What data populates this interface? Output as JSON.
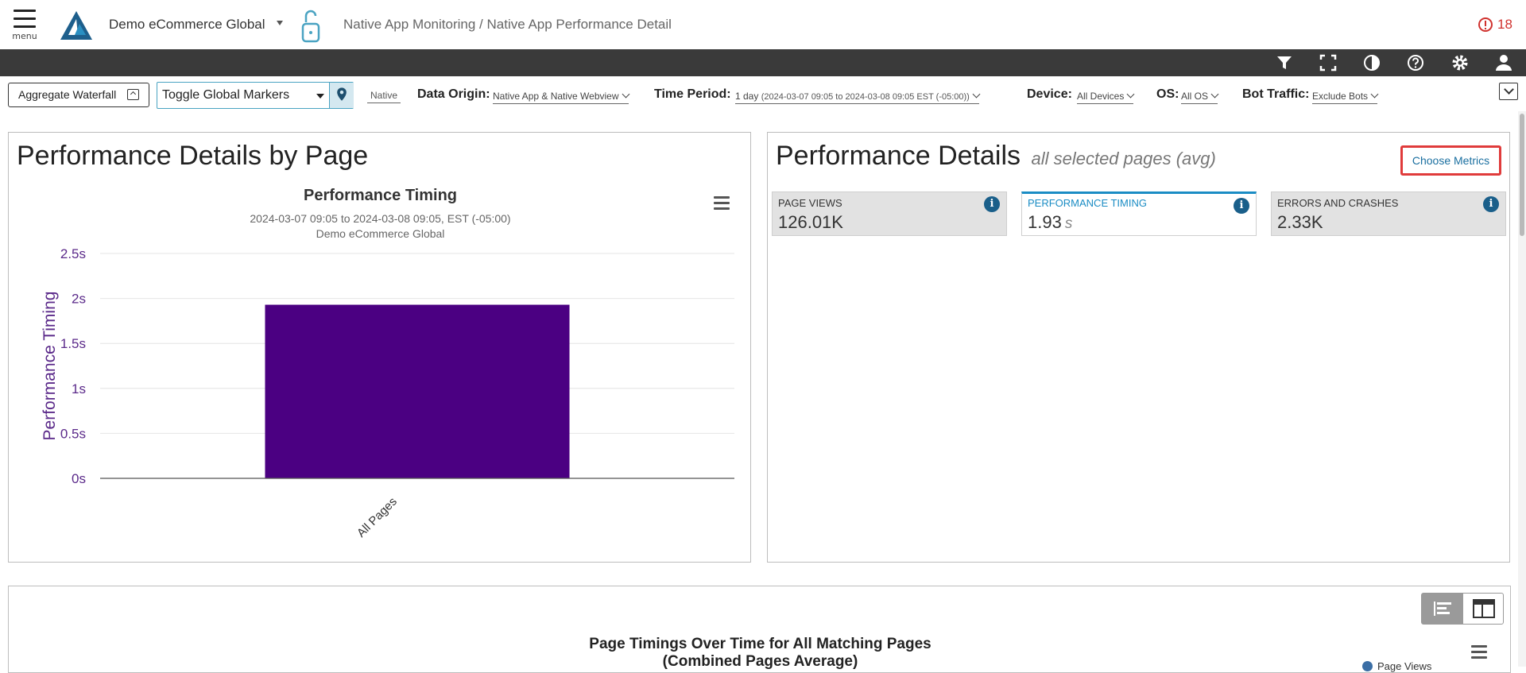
{
  "header": {
    "menu_label": "menu",
    "app_name": "Demo eCommerce Global",
    "breadcrumb": "Native App Monitoring / Native App Performance Detail",
    "alert_count": "18"
  },
  "toolbar_icons": [
    "filter-icon",
    "fullscreen-icon",
    "contrast-icon",
    "help-icon",
    "gear-icon",
    "user-icon"
  ],
  "filters": {
    "aggregate_waterfall_label": "Aggregate Waterfall",
    "global_markers": "Toggle Global Markers",
    "native_tag": "Native",
    "data_origin_label": "Data Origin:",
    "data_origin_value": "Native App & Native Webview",
    "time_period_label": "Time Period:",
    "time_period_value": "1 day",
    "time_period_range": "(2024-03-07 09:05 to 2024-03-08 09:05 EST (-05:00))",
    "device_label": "Device:",
    "device_value": "All Devices",
    "os_label": "OS:",
    "os_value": "All OS",
    "bot_label": "Bot Traffic:",
    "bot_value": "Exclude Bots"
  },
  "left_panel": {
    "title": "Performance Details by Page"
  },
  "chart_data": {
    "type": "bar",
    "title": "Performance Timing",
    "subtitle": "2024-03-07 09:05 to 2024-03-08 09:05, EST (-05:00)",
    "subtitle2": "Demo eCommerce Global",
    "categories": [
      "All Pages"
    ],
    "values": [
      1.93
    ],
    "ylabel": "Performance Timing",
    "xlabel": "",
    "ylim": [
      0,
      2.5
    ],
    "yticks": [
      "0s",
      "0.5s",
      "1s",
      "1.5s",
      "2s",
      "2.5s"
    ],
    "ytick_values": [
      0,
      0.5,
      1,
      1.5,
      2,
      2.5
    ],
    "bar_color": "#4b0082",
    "axis_color": "#5b2a8a",
    "grid": true
  },
  "right_panel": {
    "title": "Performance Details",
    "subtitle": "all selected pages (avg)",
    "choose_metrics_label": "Choose Metrics",
    "metrics": [
      {
        "label": "Page Views",
        "value": "126.01K",
        "unit": "",
        "active": false
      },
      {
        "label": "Performance Timing",
        "value": "1.93",
        "unit": "s",
        "active": true
      },
      {
        "label": "Errors and Crashes",
        "value": "2.33K",
        "unit": "",
        "active": false
      }
    ]
  },
  "bottom_panel": {
    "title_line1": "Page Timings Over Time for All Matching Pages",
    "title_line2": "(Combined Pages Average)",
    "legend_item": "Page Views"
  },
  "colors": {
    "accent": "#1a8cc4",
    "alert": "#d0312d",
    "darkbar": "#3a3a3a",
    "highlight_border": "#e03b3b"
  }
}
